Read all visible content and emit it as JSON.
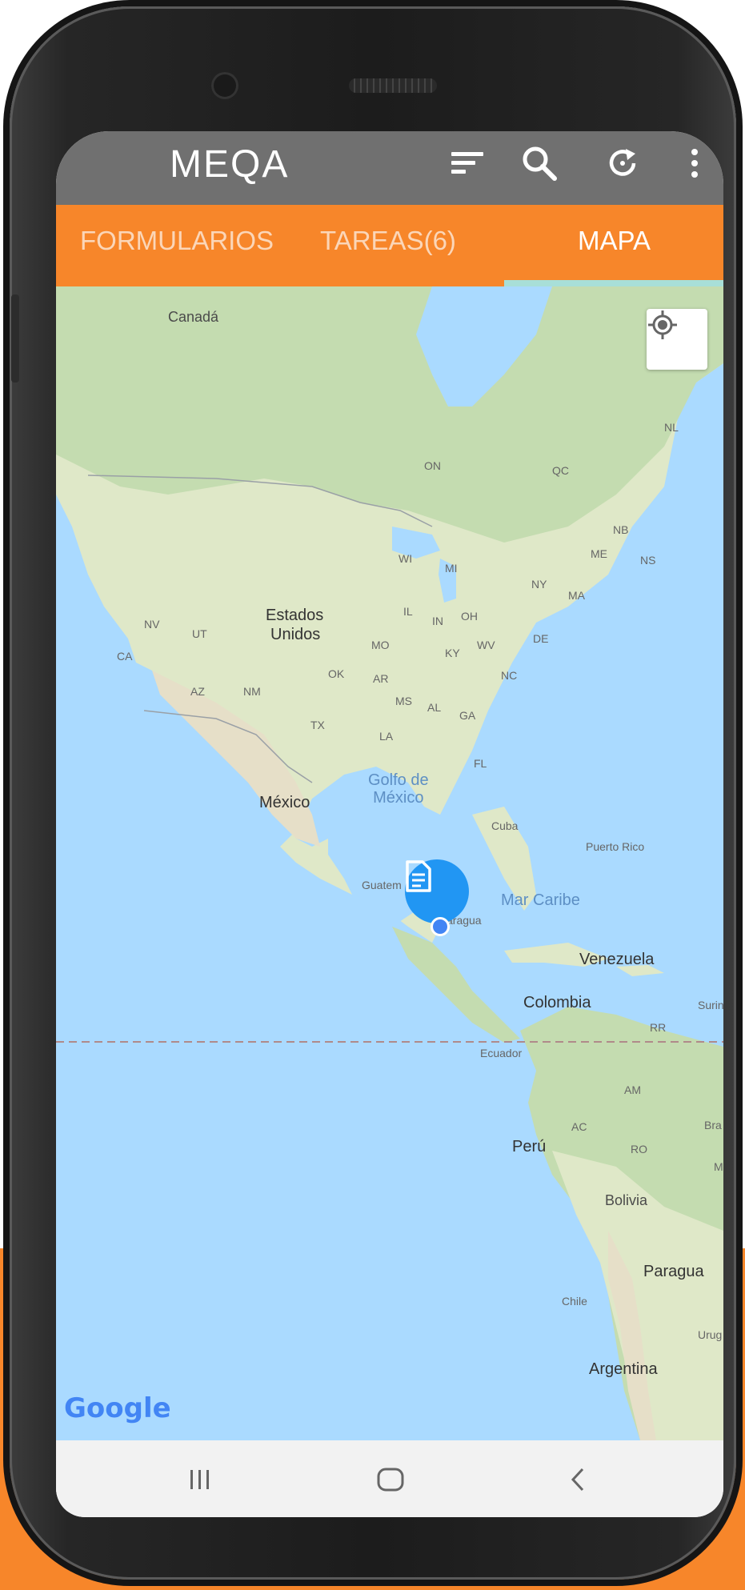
{
  "appbar": {
    "title": "MEQA",
    "icons": [
      "sort-icon",
      "search-icon",
      "refresh-icon",
      "more-vert-icon"
    ]
  },
  "tabs": [
    {
      "label": "FORMULARIOS",
      "active": false
    },
    {
      "label": "TAREAS(6)",
      "active": false
    },
    {
      "label": "MAPA",
      "active": true
    }
  ],
  "map": {
    "labels": {
      "canada": "Canadá",
      "on": "ON",
      "qc": "QC",
      "nl": "NL",
      "nb": "NB",
      "me": "ME",
      "ns": "NS",
      "wi": "WI",
      "mi": "MI",
      "ny": "NY",
      "ma": "MA",
      "nv": "NV",
      "ut": "UT",
      "ca": "CA",
      "estados": "Estados",
      "unidos": "Unidos",
      "il": "IL",
      "in": "IN",
      "oh": "OH",
      "mo": "MO",
      "ky": "KY",
      "wv": "WV",
      "de": "DE",
      "az": "AZ",
      "nm": "NM",
      "ok": "OK",
      "ar": "AR",
      "nc": "NC",
      "tx": "TX",
      "ms": "MS",
      "al": "AL",
      "ga": "GA",
      "la": "LA",
      "fl": "FL",
      "golfo_1": "Golfo de",
      "golfo_2": "México",
      "mexico": "México",
      "cuba": "Cuba",
      "puerto_rico": "Puerto Rico",
      "guatemala": "Guatem",
      "nicaragua": "aragua",
      "mar_caribe": "Mar Caribe",
      "venezuela": "Venezuela",
      "colombia": "Colombia",
      "suriname": "Surin",
      "rr": "RR",
      "ecuador": "Ecuador",
      "am": "AM",
      "brasil": "Bra",
      "ac": "AC",
      "ro": "RO",
      "peru": "Perú",
      "m": "M",
      "bolivia": "Bolivia",
      "paraguay": "Paragua",
      "chile": "Chile",
      "uruguay": "Urug",
      "argentina": "Argentina"
    },
    "attribution": "Google",
    "locate_icon": "my-location-icon",
    "marker_icon": "document-icon"
  },
  "navbar": {
    "icons": [
      "recent-apps-icon",
      "home-icon",
      "back-icon"
    ]
  },
  "colors": {
    "accent": "#f7862a",
    "appbar": "#707070",
    "tab_indicator": "#a8dfd8",
    "water": "#aadaff",
    "marker": "#2196f3"
  }
}
